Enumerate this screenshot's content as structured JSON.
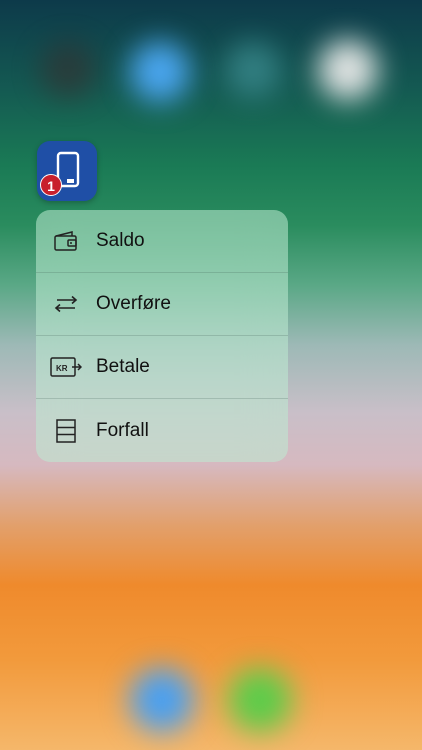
{
  "app": {
    "badge_count": "1",
    "icon_color": "#1f4fa6",
    "badge_color": "#c8202c"
  },
  "quick_actions": [
    {
      "label": "Saldo",
      "icon": "wallet-icon"
    },
    {
      "label": "Overføre",
      "icon": "transfer-arrows-icon"
    },
    {
      "label": "Betale",
      "icon": "kr-pay-icon"
    },
    {
      "label": "Forfall",
      "icon": "list-rows-icon"
    }
  ]
}
